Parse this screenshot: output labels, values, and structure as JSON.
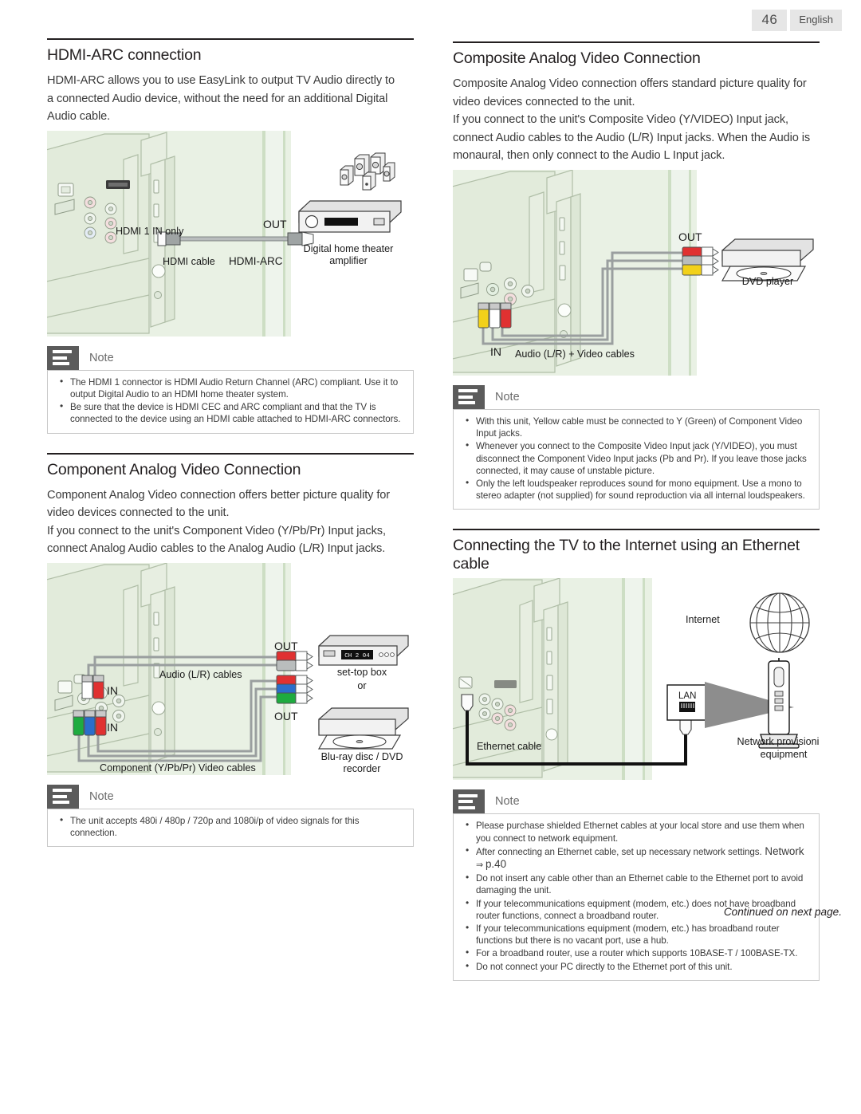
{
  "page": {
    "number": "46",
    "language_tab": "English",
    "footer_note": "Continued on next page."
  },
  "sections": [
    {
      "id": "hdmi-arc",
      "title": "HDMI-ARC connection",
      "paragraphs": [
        "HDMI-ARC allows you to use EasyLink to output TV Audio directly to",
        "a connected Audio device, without the need for an additional Digital",
        "Audio cable."
      ],
      "diagram": {
        "labels": {
          "port": "HDMI 1 IN only",
          "cable": "HDMI cable",
          "arc": "HDMI-ARC",
          "out": "OUT",
          "device_line1": "Digital home theater",
          "device_line2": "amplifier"
        }
      },
      "note": {
        "title": "Note",
        "items": [
          "The HDMI 1 connector is HDMI Audio Return Channel (ARC) compliant. Use it to output Digital Audio to an HDMI home theater system.",
          "Be sure that the device is HDMI CEC and ARC compliant and that the TV is connected to the device using an HDMI cable attached to HDMI-ARC connectors."
        ]
      }
    },
    {
      "id": "component",
      "title": "Component Analog Video Connection",
      "paragraphs": [
        "Component Analog Video connection offers better picture quality for",
        "video devices connected to the unit.",
        "If you connect to the unit's Component Video (Y/Pb/Pr) Input jacks,",
        "connect Analog Audio cables to the Analog Audio (L/R) Input jacks."
      ],
      "diagram": {
        "labels": {
          "out_top": "OUT",
          "out_bottom": "OUT",
          "in_top": "IN",
          "in_bottom": "IN",
          "audio_cables": "Audio (L/R) cables",
          "component_cables": "Component (Y/Pb/Pr) Video cables",
          "device1": "set-top box",
          "device_or": "or",
          "device2_line1": "Blu-ray disc / DVD",
          "device2_line2": "recorder",
          "stb_display": "CH 2 04"
        }
      },
      "note": {
        "title": "Note",
        "items": [
          "The unit accepts 480i / 480p / 720p and 1080i/p of video signals for this connection."
        ]
      }
    },
    {
      "id": "composite",
      "title": "Composite Analog Video Connection",
      "paragraphs": [
        "Composite Analog Video connection offers standard picture quality for",
        "video devices connected to the unit.",
        "If you connect to the unit's Composite Video (Y/VIDEO) Input jack,",
        "connect Audio cables to the Audio (L/R) Input jacks. When the Audio is",
        "monaural, then only connect to the Audio L Input jack."
      ],
      "diagram": {
        "labels": {
          "out": "OUT",
          "in": "IN",
          "cables": "Audio (L/R) + Video cables",
          "device": "DVD player"
        }
      },
      "note": {
        "title": "Note",
        "items": [
          "With this unit, Yellow cable must be connected to Y (Green) of Component Video Input jacks.",
          "Whenever you connect to the Composite Video Input jack (Y/VIDEO), you must disconnect the Component Video Input jacks (Pb and Pr). If you leave those jacks connected, it may cause of unstable picture.",
          "Only the left loudspeaker reproduces sound for mono equipment. Use a mono to stereo adapter (not supplied) for sound reproduction via all internal loudspeakers."
        ]
      }
    },
    {
      "id": "ethernet",
      "title": "Connecting the TV to the Internet using an Ethernet cable",
      "paragraphs": [],
      "diagram": {
        "labels": {
          "internet": "Internet",
          "lan": "LAN",
          "cable": "Ethernet cable",
          "device_line1": "Network provisioning",
          "device_line2": "equipment"
        }
      },
      "note": {
        "title": "Note",
        "items": [
          "Please purchase shielded Ethernet cables at your local store and use them when you connect to network equipment.",
          "After connecting an Ethernet cable, set up necessary network settings.",
          "Do not insert any cable other than an Ethernet cable to the Ethernet port to avoid damaging the unit.",
          "If your telecommunications equipment (modem, etc.) does not have broadband router functions, connect a broadband router.",
          "If your telecommunications equipment (modem, etc.) has broadband router functions but there is no vacant port, use a hub.",
          "For a broadband router, use a router which supports 10BASE-T / 100BASE-TX.",
          "Do not connect your PC directly to the Ethernet port of this unit."
        ],
        "inline_ref": {
          "label": "Network",
          "arrow": "⇒",
          "page": "p.40"
        }
      }
    }
  ],
  "colors": {
    "diagram_bg": "#e9f1e4",
    "note_icon_bg": "#5b5b5b",
    "text": "#231f20",
    "jack_red": "#e03131",
    "jack_blue": "#2b6ecb",
    "jack_green": "#1eab3f",
    "jack_yellow": "#f2d11a",
    "jack_white": "#ffffff"
  }
}
